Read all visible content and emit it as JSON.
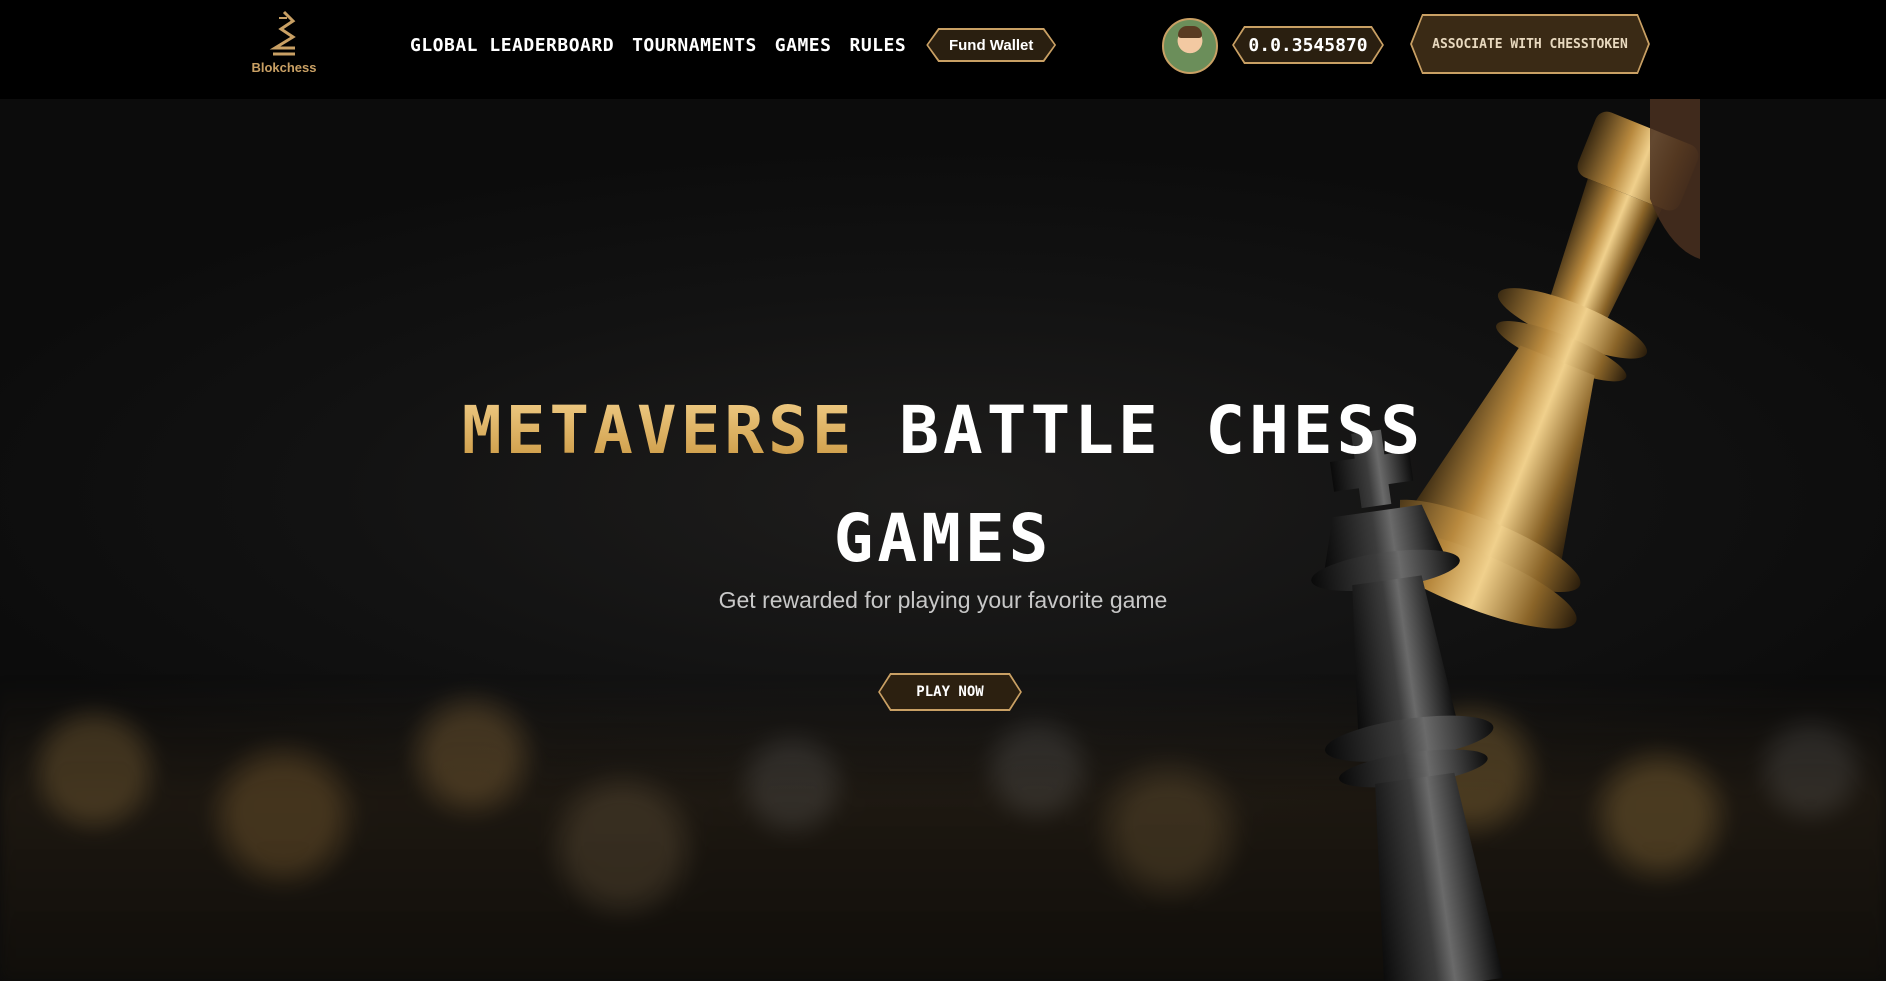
{
  "brand": {
    "name": "Blokchess"
  },
  "nav": {
    "items": [
      {
        "label": "Global Leaderboard"
      },
      {
        "label": "Tournaments"
      },
      {
        "label": "Games"
      },
      {
        "label": "Rules"
      }
    ],
    "fund_wallet_label": "Fund Wallet"
  },
  "account": {
    "avatar": "user-avatar",
    "balance": "0.0.3545870",
    "associate_label": "Associate with Chesstoken"
  },
  "hero": {
    "title_highlight": "Metaverse",
    "title_rest": "Battle Chess",
    "title_line2": "Games",
    "subtitle": "Get rewarded for playing your favorite game",
    "cta_label": "Play Now"
  },
  "colors": {
    "accent_gold": "#c9a064",
    "background": "#000000",
    "hero_background": "#121212",
    "text": "#ffffff"
  },
  "icons": {
    "logo": "blokchess-knight-logo-icon"
  }
}
